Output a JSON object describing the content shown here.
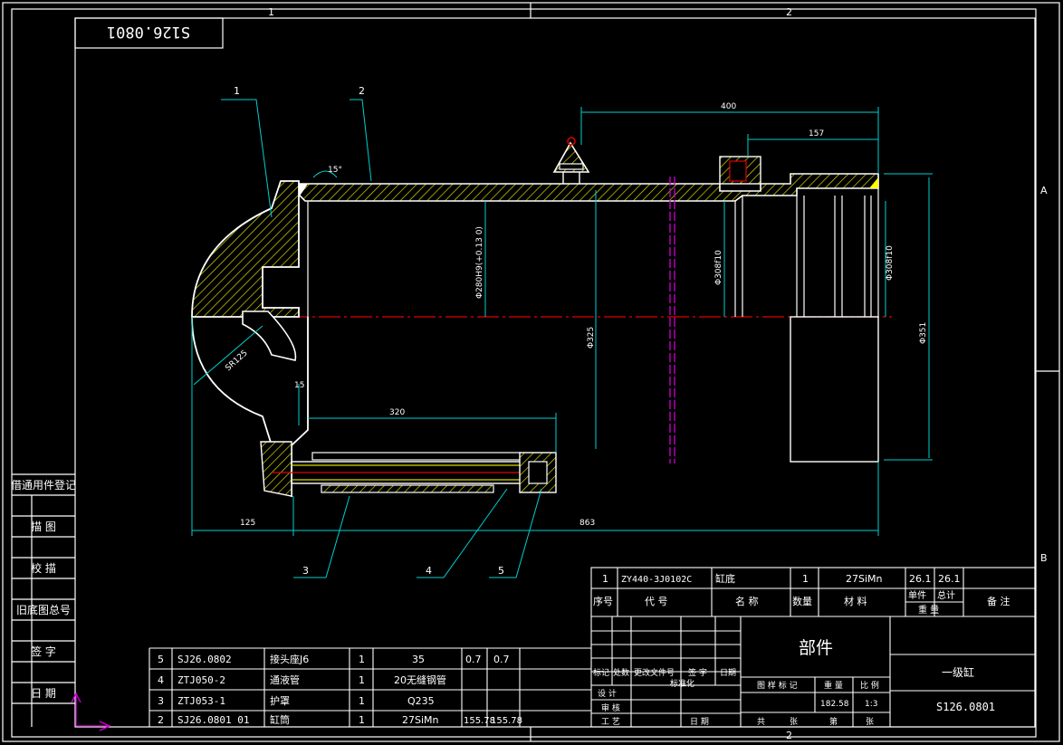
{
  "frame": {
    "zone_top_1": "1",
    "zone_top_2": "2",
    "zone_bottom_2": "2",
    "zone_right_a": "A",
    "zone_right_b": "B",
    "rotated_code": "S126.0801"
  },
  "left_strip": [
    "借通用件登记",
    "描 图",
    "校 描",
    "旧底图总号",
    "签 字",
    "日 期"
  ],
  "callouts": [
    "1",
    "2",
    "3",
    "4",
    "5"
  ],
  "dimensions": {
    "d400": "400",
    "d157": "157",
    "d320": "320",
    "d125": "125",
    "d863": "863",
    "d15": "15",
    "angle": "15°",
    "sr": "SR125",
    "bore": "Φ280H9(+0.13 0)",
    "d325": "Φ325",
    "d351": "Φ351",
    "d308": "Φ308f10",
    "d308b": "Φ308f10"
  },
  "parts_list": [
    {
      "no": "5",
      "code": "SJ26.0802",
      "name": "接头座J6",
      "qty": "1",
      "material": "35",
      "unit_w": "0.7",
      "total_w": "0.7"
    },
    {
      "no": "4",
      "code": "ZTJ050-2",
      "name": "通液管",
      "qty": "1",
      "material": "20无缝钢管",
      "unit_w": "",
      "total_w": ""
    },
    {
      "no": "3",
      "code": "ZTJ053-1",
      "name": "护罩",
      "qty": "1",
      "material": "Q235",
      "unit_w": "",
      "total_w": ""
    },
    {
      "no": "2",
      "code": "SJ26.0801 01",
      "name": "缸筒",
      "qty": "1",
      "material": "27SiMn",
      "unit_w": "155.78",
      "total_w": "155.78"
    }
  ],
  "part1_row": {
    "no": "1",
    "code": "ZY440-3J0102C",
    "name": "缸底",
    "qty": "1",
    "material": "27SiMn",
    "unit_w": "26.1",
    "total_w": "26.1"
  },
  "header_row": {
    "no": "序号",
    "code": "代 号",
    "name": "名 称",
    "qty": "数量",
    "material": "材 料",
    "unit": "单件",
    "total": "总计",
    "weight": "重 量",
    "remark": "备 注"
  },
  "title_block": {
    "part_type": "部件",
    "product_name": "一级缸",
    "drawing_no": "S126.0801",
    "mark": "标记",
    "count": "处数",
    "change_doc": "更改文件号",
    "sign": "签 字",
    "date": "日期",
    "designer": "设 计",
    "standardize": "标准化",
    "drawing_label": "图 样 标 记",
    "weight_label": "重 量",
    "scale_label": "比 例",
    "weight": "182.58",
    "scale": "1:3",
    "review": "审 核",
    "process": "工 艺",
    "date2": "日 期",
    "total_sheets": "共",
    "sheet": "张",
    "page": "第",
    "sheet2": "张"
  }
}
